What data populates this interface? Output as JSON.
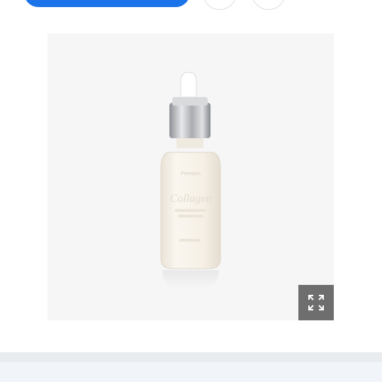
{
  "toolbar": {
    "primary_button_label": "",
    "share_icon": "share-icon",
    "favorite_icon": "heart-icon"
  },
  "product_image": {
    "alt": "",
    "bottle_label_lines": [
      "Premium",
      "Collagen"
    ],
    "colors": {
      "background": "#f6f6f6",
      "bottle_fill": "#f4efe6",
      "cap": "#b9bcc1",
      "dropper": "#ffffff"
    }
  },
  "expand_button": {
    "icon": "expand-icon"
  },
  "colors": {
    "primary": "#1a73e8",
    "expand_bg": "#6e6e6e",
    "divider": "#e9ecef"
  }
}
